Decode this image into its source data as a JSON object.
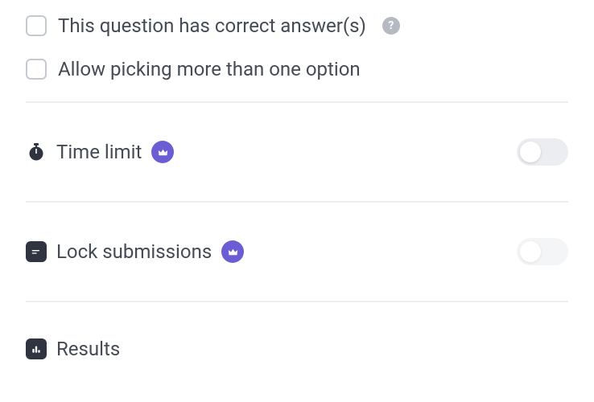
{
  "options": {
    "correct_answers": {
      "label": "This question has correct answer(s)",
      "checked": false
    },
    "multiple_options": {
      "label": "Allow picking more than one option",
      "checked": false
    }
  },
  "sections": {
    "time_limit": {
      "label": "Time limit",
      "premium": true,
      "enabled": false
    },
    "lock_submissions": {
      "label": "Lock submissions",
      "premium": true,
      "enabled": false
    },
    "results": {
      "label": "Results"
    }
  }
}
